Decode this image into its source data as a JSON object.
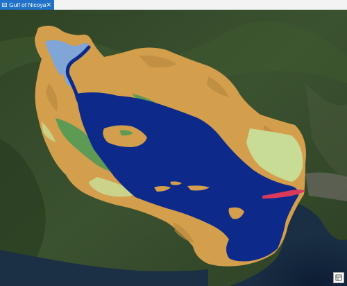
{
  "tab": {
    "title": "Gulf of Nicoya",
    "icon": "map-icon",
    "close_icon": "close-icon"
  },
  "map": {
    "basemap": "satellite-imagery",
    "layer_colors": {
      "open_water": "#0d2a8a",
      "agriculture_grassland": "#d4a24a",
      "forest_mangrove": "#5f9a55",
      "pasture_light": "#c9dc96",
      "shallow_water": "#7fa6d6",
      "urban": "#d93a5c",
      "outside_study_area": "#2e4020"
    },
    "tools_icon": "map-tools-icon"
  }
}
